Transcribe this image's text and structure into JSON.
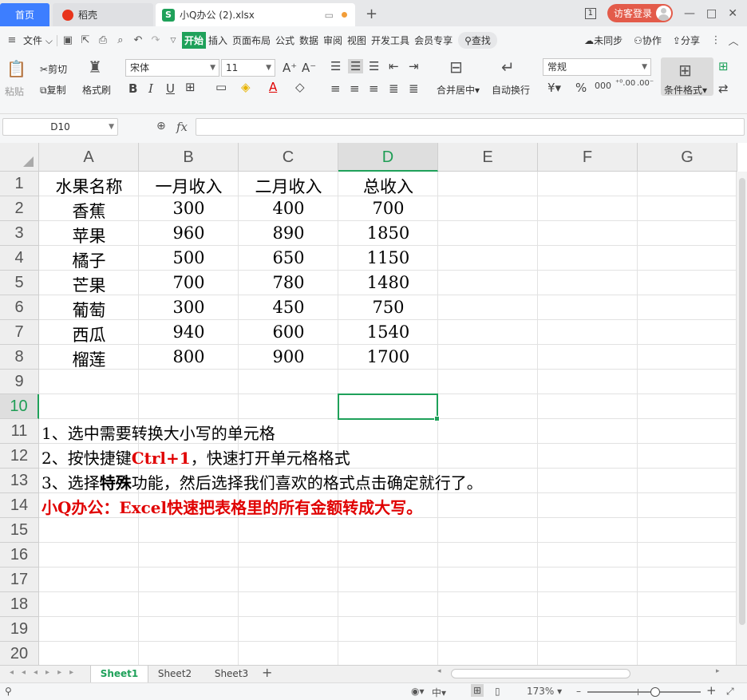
{
  "titlebar": {
    "home_tab": "首页",
    "daoke_tab": "稻壳",
    "file_tab": "小Q办公 (2).xlsx",
    "file_icon_letter": "S",
    "plus": "+",
    "window_number": "1",
    "guest_login": "访客登录",
    "minimize": "—",
    "maximize": "□",
    "close": "✕"
  },
  "menubar": {
    "file_menu": "文件",
    "tabs": [
      "开始",
      "插入",
      "页面布局",
      "公式",
      "数据",
      "审阅",
      "视图",
      "开发工具",
      "会员专享"
    ],
    "search": "查找",
    "sync": "未同步",
    "collab": "协作",
    "share": "分享"
  },
  "ribbon": {
    "paste": "粘贴",
    "cut": "剪切",
    "copy": "复制",
    "format_painter": "格式刷",
    "font_name": "宋体",
    "font_size": "11",
    "merge_center": "合并居中",
    "auto_wrap": "自动换行",
    "number_format": "常规",
    "conditional_format": "条件格式"
  },
  "formula_bar": {
    "cell_ref": "D10",
    "fx": "fx",
    "formula": ""
  },
  "sheet": {
    "columns": [
      "A",
      "B",
      "C",
      "D",
      "E",
      "F",
      "G"
    ],
    "selected_column": "D",
    "rows": [
      "1",
      "2",
      "3",
      "4",
      "5",
      "6",
      "7",
      "8",
      "9",
      "10",
      "11",
      "12",
      "13",
      "14",
      "15",
      "16",
      "17",
      "18",
      "19",
      "20"
    ],
    "selected_row": "10",
    "header": [
      "水果名称",
      "一月收入",
      "二月收入",
      "总收入"
    ],
    "data": [
      [
        "香蕉",
        "300",
        "400",
        "700"
      ],
      [
        "苹果",
        "960",
        "890",
        "1850"
      ],
      [
        "橘子",
        "500",
        "650",
        "1150"
      ],
      [
        "芒果",
        "700",
        "780",
        "1480"
      ],
      [
        "葡萄",
        "300",
        "450",
        "750"
      ],
      [
        "西瓜",
        "940",
        "600",
        "1540"
      ],
      [
        "榴莲",
        "800",
        "900",
        "1700"
      ]
    ],
    "notes": {
      "n11": "1、选中需要转换大小写的单元格",
      "n12_a": "2、按快捷键",
      "n12_key": "Ctrl+1",
      "n12_b": "，快速打开单元格格式",
      "n13_a": "3、选择",
      "n13_bold": "特殊",
      "n13_b": "功能，然后选择我们喜欢的格式点击确定就行了。",
      "n14": "小Q办公：Excel快速把表格里的所有金额转成大写。"
    }
  },
  "sheet_tabs": [
    "Sheet1",
    "Sheet2",
    "Sheet3"
  ],
  "status": {
    "zoom": "173%",
    "minus": "–",
    "plus": "+"
  },
  "colors": {
    "accent_green": "#1fa15a",
    "home_blue": "#3d7eff",
    "guest_red": "#e35b4a",
    "note_red": "#e00000"
  }
}
